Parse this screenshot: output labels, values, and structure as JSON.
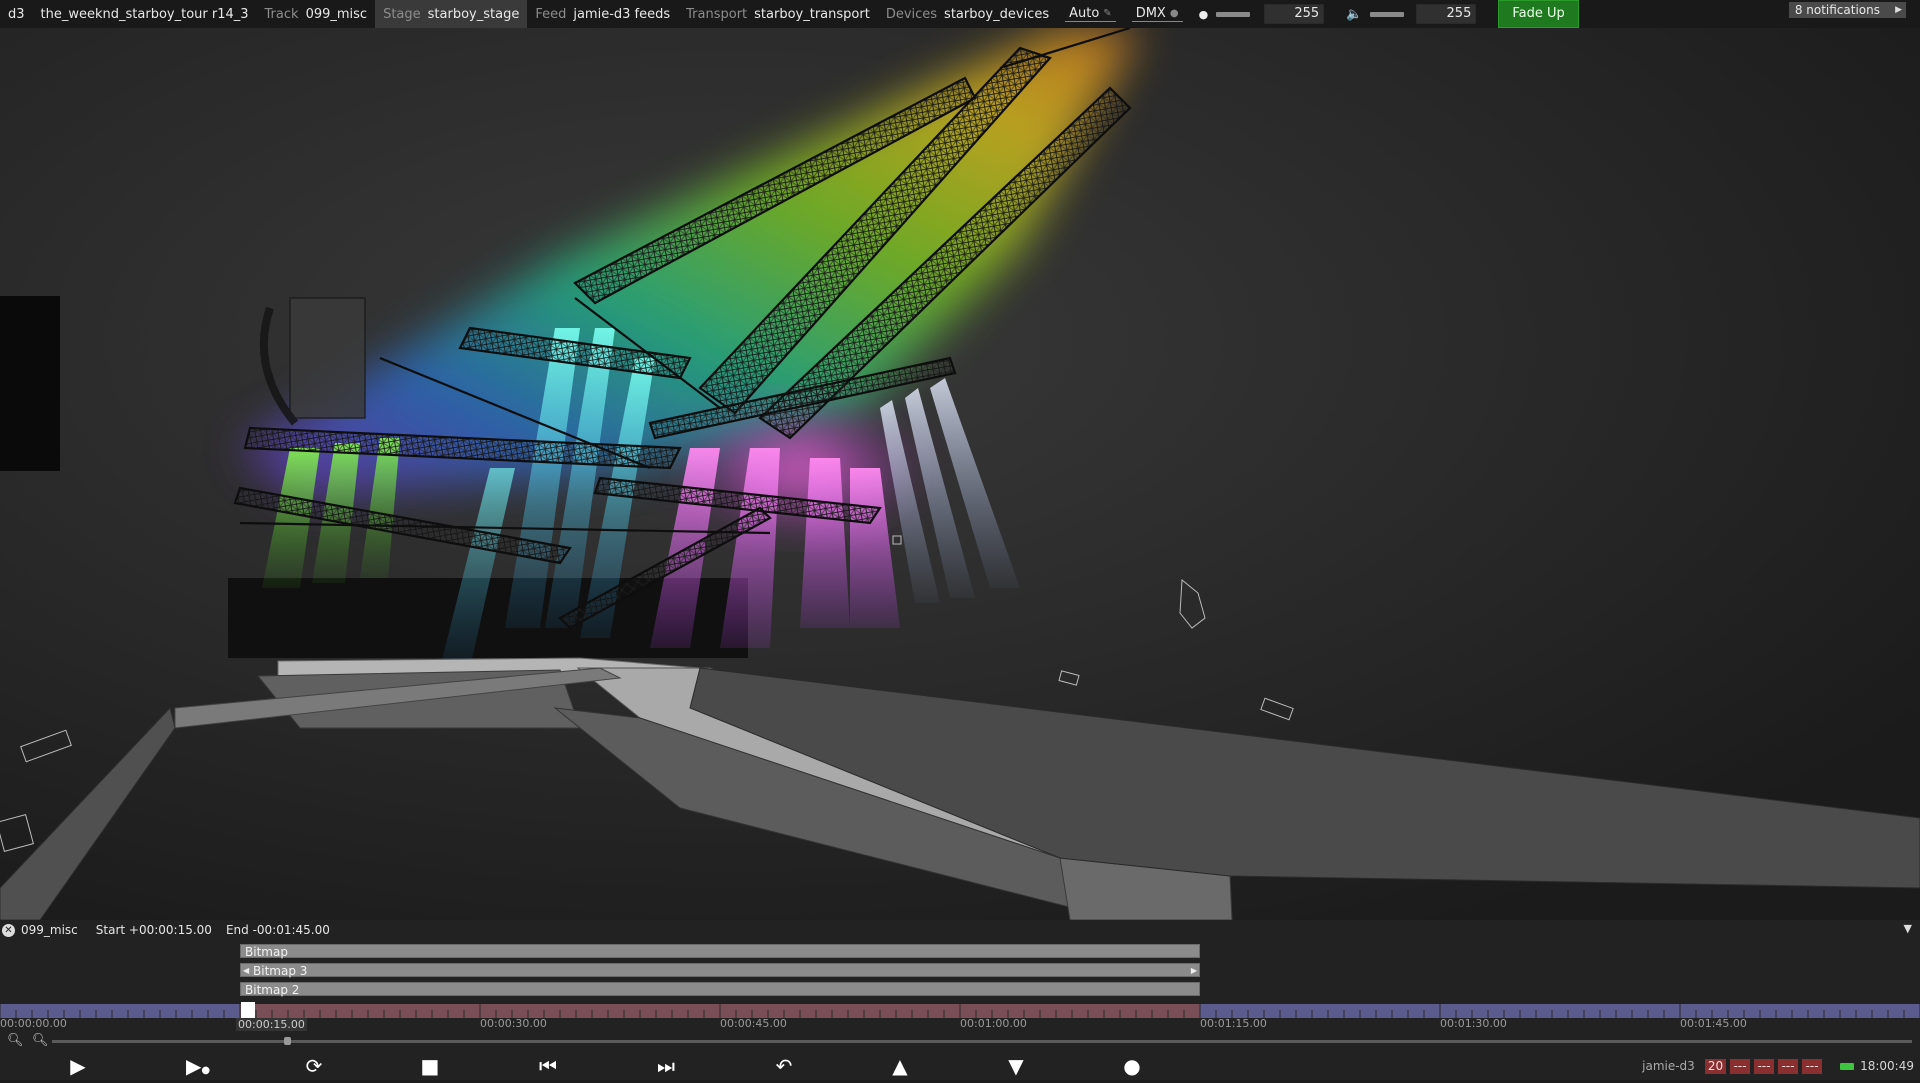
{
  "app": {
    "name": "d3",
    "project": "the_weeknd_starboy_tour r14_3"
  },
  "topbar": {
    "track_label": "Track",
    "track_value": "099_misc",
    "stage_label": "Stage",
    "stage_value": "starboy_stage",
    "feed_label": "Feed",
    "feed_value": "jamie-d3 feeds",
    "transport_label": "Transport",
    "transport_value": "starboy_transport",
    "devices_label": "Devices",
    "devices_value": "starboy_devices",
    "auto_label": "Auto",
    "dmx_label": "DMX",
    "brightness_value": "255",
    "volume_value": "255",
    "fade_up_label": "Fade Up",
    "notifications_label": "8 notifications"
  },
  "timeline": {
    "track_name": "099_misc",
    "start_text": "Start +00:00:15.00",
    "end_text": "End -00:01:45.00",
    "layers": [
      {
        "name": "Bitmap"
      },
      {
        "name": "Bitmap 3"
      },
      {
        "name": "Bitmap 2"
      }
    ],
    "ticks": [
      "00:00:00.00",
      "00:00:30.00",
      "00:00:45.00",
      "00:01:00.00",
      "00:01:15.00",
      "00:01:30.00",
      "00:01:45.00"
    ],
    "playhead_time": "00:00:15.00"
  },
  "status": {
    "user": "jamie-d3",
    "fps_badge": "20",
    "dash_badges": [
      "---",
      "---",
      "---",
      "---"
    ],
    "clock": "18:00:49"
  },
  "colors": {
    "accent_green": "#1f7a1f",
    "status_red": "#8a2f2f",
    "section_blue": "#5b5b8e",
    "section_red": "#7a4e56"
  },
  "icons": {
    "play": "play-icon",
    "play_section": "play-to-end-icon",
    "loop": "loop-icon",
    "stop": "stop-icon",
    "prev": "previous-section-icon",
    "next": "next-section-icon",
    "return": "return-icon",
    "up": "triangle-up-icon",
    "down": "triangle-down-icon",
    "record": "record-icon"
  }
}
